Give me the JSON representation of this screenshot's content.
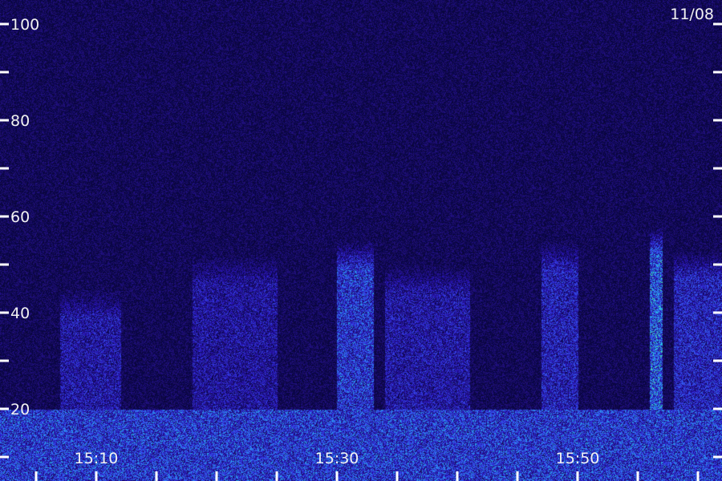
{
  "date_label": "11/08",
  "chart_data": {
    "type": "heatmap",
    "title": "",
    "xlabel": "",
    "ylabel": "",
    "y_ticks": [
      100,
      80,
      60,
      40,
      20
    ],
    "y_minor_ticks": [
      90,
      70,
      50,
      30,
      10
    ],
    "ylim": [
      10,
      105
    ],
    "x_tick_labels": [
      "15:10",
      "15:30",
      "15:50"
    ],
    "xlim_minutes_labels": [
      "15:02",
      "16:02"
    ],
    "colormap": [
      "#0a0620",
      "#1a0c6e",
      "#2b1bd0",
      "#3f5bff",
      "#22c8d8",
      "#6ef26a"
    ],
    "bursts": [
      {
        "start": "15:07",
        "end": "15:12",
        "top_hz": 45,
        "intensity": 0.45
      },
      {
        "start": "15:18",
        "end": "15:25",
        "top_hz": 52,
        "intensity": 0.4
      },
      {
        "start": "15:30",
        "end": "15:33",
        "top_hz": 55,
        "intensity": 0.75
      },
      {
        "start": "15:34",
        "end": "15:41",
        "top_hz": 50,
        "intensity": 0.45
      },
      {
        "start": "15:47",
        "end": "15:50",
        "top_hz": 55,
        "intensity": 0.55
      },
      {
        "start": "15:56",
        "end": "15:57",
        "top_hz": 58,
        "intensity": 0.95
      },
      {
        "start": "15:58",
        "end": "16:02",
        "top_hz": 53,
        "intensity": 0.6
      }
    ],
    "low_band_top_hz": 20
  }
}
